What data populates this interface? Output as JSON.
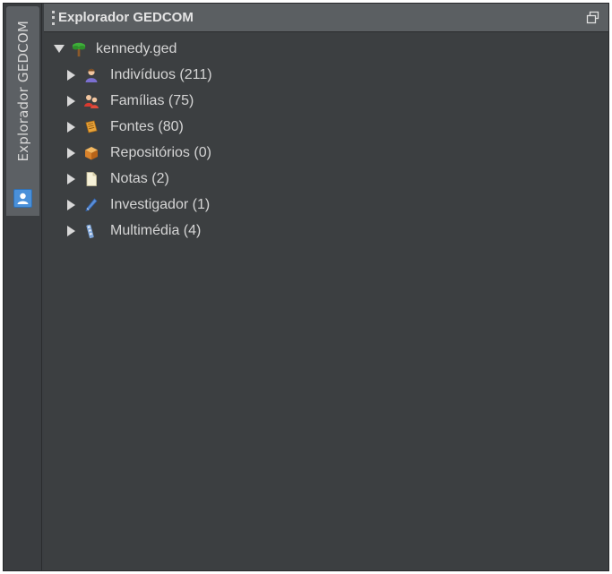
{
  "sidebar": {
    "tab_label": "Explorador GEDCOM",
    "tab_icon": "person-card-icon"
  },
  "panel": {
    "title": "Explorador GEDCOM",
    "restore_icon": "restore-window-icon"
  },
  "tree": {
    "root": {
      "label": "kennedy.ged",
      "icon": "family-tree-icon",
      "expanded": true
    },
    "children": [
      {
        "label": "Indivíduos (211)",
        "icon": "individual-icon"
      },
      {
        "label": "Famílias (75)",
        "icon": "family-icon"
      },
      {
        "label": "Fontes (80)",
        "icon": "source-book-icon"
      },
      {
        "label": "Repositórios (0)",
        "icon": "repository-box-icon"
      },
      {
        "label": "Notas (2)",
        "icon": "note-icon"
      },
      {
        "label": "Investigador (1)",
        "icon": "researcher-pen-icon"
      },
      {
        "label": "Multimédia (4)",
        "icon": "multimedia-icon"
      }
    ]
  },
  "colors": {
    "panel_bg": "#3c3f41",
    "title_bg": "#5b5f62",
    "text": "#d5d5d5",
    "tab_icon_blue": "#4a90d9"
  }
}
